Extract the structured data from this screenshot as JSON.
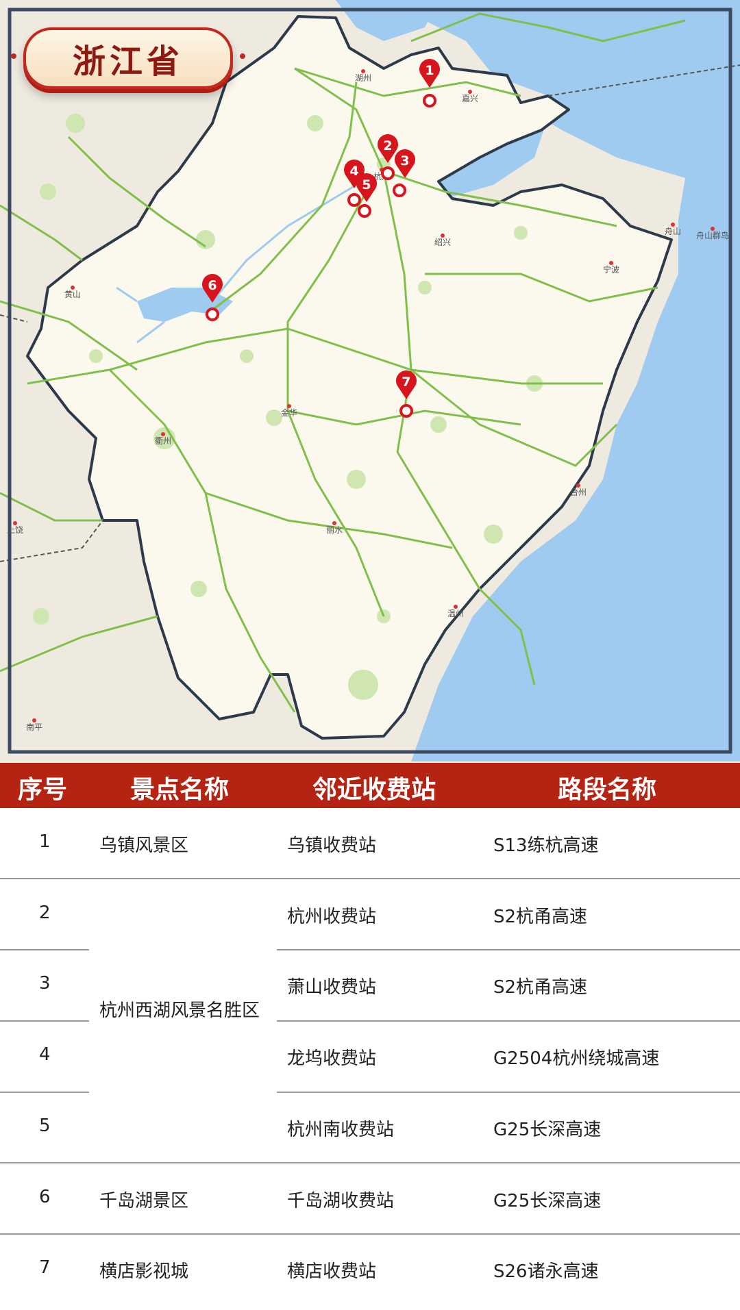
{
  "province_title": "浙江省",
  "map": {
    "cities": [
      {
        "name": "湖州"
      },
      {
        "name": "嘉兴"
      },
      {
        "name": "杭州"
      },
      {
        "name": "绍兴"
      },
      {
        "name": "宁波"
      },
      {
        "name": "舟山"
      },
      {
        "name": "舟山群岛"
      },
      {
        "name": "黄山"
      },
      {
        "name": "衢州"
      },
      {
        "name": "金华"
      },
      {
        "name": "丽水"
      },
      {
        "name": "台州"
      },
      {
        "name": "温州"
      },
      {
        "name": "上饶"
      },
      {
        "name": "南平"
      }
    ],
    "markers": [
      "1",
      "2",
      "3",
      "4",
      "5",
      "6",
      "7"
    ]
  },
  "table": {
    "headers": [
      "序号",
      "景点名称",
      "邻近收费站",
      "路段名称"
    ],
    "rows": [
      {
        "no": "1",
        "toll": "乌镇收费站",
        "road": "S13练杭高速"
      },
      {
        "no": "2",
        "toll": "杭州收费站",
        "road": "S2杭甬高速"
      },
      {
        "no": "3",
        "toll": "萧山收费站",
        "road": "S2杭甬高速"
      },
      {
        "no": "4",
        "toll": "龙坞收费站",
        "road": "G2504杭州绕城高速"
      },
      {
        "no": "5",
        "toll": "杭州南收费站",
        "road": "G25长深高速"
      },
      {
        "no": "6",
        "toll": "千岛湖收费站",
        "road": "G25长深高速"
      },
      {
        "no": "7",
        "toll": "横店收费站",
        "road": "S26诸永高速"
      }
    ],
    "scenic_spots": [
      "乌镇风景区",
      "杭州西湖风景名胜区",
      "千岛湖景区",
      "横店影视城"
    ]
  },
  "colors": {
    "header_bg": "#b52412",
    "marker": "#d8141c",
    "sea": "#9ecbef",
    "province_fill": "#fbf8ee",
    "roads": "#7fbf4a",
    "border": "#2c3a4a"
  }
}
